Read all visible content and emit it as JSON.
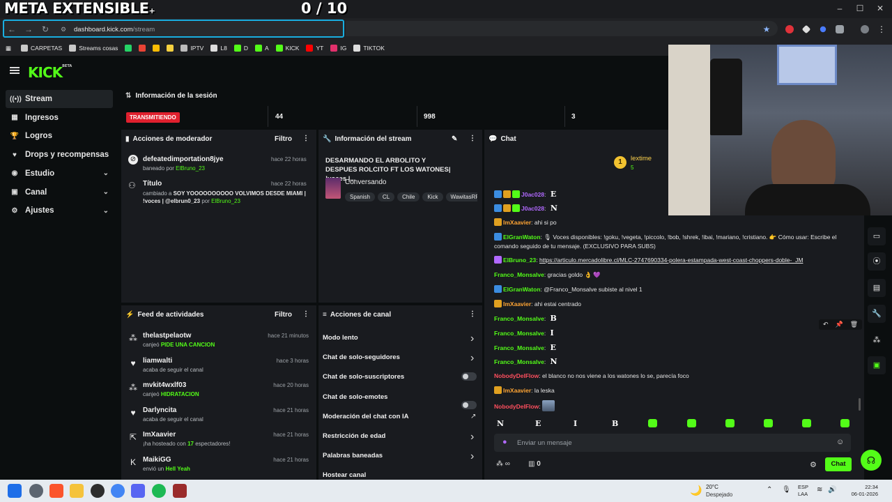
{
  "overlay": {
    "title": "META EXTENSIBLE",
    "plus": "+",
    "counter": "0 / 10"
  },
  "browser": {
    "url_host": "dashboard.kick.com",
    "url_path": "/stream",
    "window_controls": [
      "–",
      "☐",
      "✕"
    ],
    "bookmarks": [
      {
        "label": "CARPETAS",
        "color": "#c9c9c9"
      },
      {
        "label": "Streams cosas",
        "color": "#c9c9c9"
      },
      {
        "label": "",
        "color": "#25d366"
      },
      {
        "label": "",
        "color": "#ea4335"
      },
      {
        "label": "",
        "color": "#fbbc04"
      },
      {
        "label": "",
        "color": "#f4d03f"
      },
      {
        "label": "IPTV",
        "color": "#bbbbbb"
      },
      {
        "label": "L8",
        "color": "#dddddd"
      },
      {
        "label": "D",
        "color": "#53fc18"
      },
      {
        "label": "A",
        "color": "#53fc18"
      },
      {
        "label": "KICK",
        "color": "#53fc18"
      },
      {
        "label": "YT",
        "color": "#ff0000"
      },
      {
        "label": "IG",
        "color": "#e1306c"
      },
      {
        "label": "TIKTOK",
        "color": "#dddddd"
      }
    ]
  },
  "kick": {
    "logo": "KICK",
    "logo_sup": "BETA",
    "nav": [
      {
        "label": "Stream",
        "icon": "stream-icon",
        "glyph": "((•))",
        "chev": false,
        "active": true
      },
      {
        "label": "Ingresos",
        "icon": "revenue-icon",
        "glyph": "▦",
        "chev": false
      },
      {
        "label": "Logros",
        "icon": "trophy-icon",
        "glyph": "🏆",
        "chev": false
      },
      {
        "label": "Drops y recompensas",
        "icon": "drops-icon",
        "glyph": "♥",
        "chev": false
      },
      {
        "label": "Estudio",
        "icon": "studio-icon",
        "glyph": "◉",
        "chev": true
      },
      {
        "label": "Canal",
        "icon": "channel-icon",
        "glyph": "▣",
        "chev": true
      },
      {
        "label": "Ajustes",
        "icon": "settings-icon",
        "glyph": "⚙",
        "chev": true
      }
    ],
    "session": {
      "title": "Información de la sesión",
      "status": "TRANSMITIENDO",
      "stats": [
        "44",
        "998",
        "3"
      ]
    },
    "mod_actions": {
      "title": "Acciones de moderador",
      "filter": "Filtro",
      "items": [
        {
          "user": "defeatedimportation8jye",
          "time": "hace 22 horas",
          "action": "baneado por",
          "by": "ElBruno_23"
        },
        {
          "user": "Título",
          "time": "hace 22 horas",
          "action": "cambiado a",
          "bold": "SOY YOOOOOOOOOO VOLVIMOS DESDE MIAMI | !voces | @elbrun0_23",
          "por": "por",
          "by": "ElBruno_23"
        }
      ]
    },
    "stream_info": {
      "title": "Información del stream",
      "stream_title": "DESARMANDO EL ARBOLITO Y DESPUES ROLCITO FT LOS WATONES| !voces |...",
      "category": "Conversando",
      "tags": [
        "Spanish",
        "CL",
        "Chile",
        "Kick",
        "WawitasRF"
      ]
    },
    "activity": {
      "title": "Feed de actividades",
      "filter": "Filtro",
      "items": [
        {
          "user": "thelastpelaotw",
          "time": "hace 21 minutos",
          "pre": "canjeó",
          "hl": "PIDE UNA CANCION",
          "post": "",
          "icon": "redeem-icon",
          "glyph": "⁂"
        },
        {
          "user": "liamwalti",
          "time": "hace 3 horas",
          "pre": "acaba de seguir el canal",
          "hl": "",
          "post": "",
          "icon": "heart-icon",
          "glyph": "♥"
        },
        {
          "user": "mvkit4wxlf03",
          "time": "hace 20 horas",
          "pre": "canjeó",
          "hl": "HIDRATACION",
          "post": "",
          "icon": "redeem-icon",
          "glyph": "⁂"
        },
        {
          "user": "Darlyncita",
          "time": "hace 21 horas",
          "pre": "acaba de seguir el canal",
          "hl": "",
          "post": "",
          "icon": "heart-icon",
          "glyph": "♥"
        },
        {
          "user": "ImXaavier",
          "time": "hace 21 horas",
          "pre": "¡ha hosteado con",
          "hl": "17",
          "post": "espectadores!",
          "icon": "host-icon",
          "glyph": "⇱"
        },
        {
          "user": "MaikiGG",
          "time": "hace 21 horas",
          "pre": "envió un",
          "hl": "Hell Yeah",
          "post": "",
          "icon": "kick-icon",
          "glyph": "K"
        }
      ]
    },
    "channel_actions": {
      "title": "Acciones de canal",
      "items": [
        {
          "label": "Modo lento",
          "ctrl": "arrow"
        },
        {
          "label": "Chat de solo-seguidores",
          "ctrl": "arrow"
        },
        {
          "label": "Chat de solo-suscriptores",
          "ctrl": "toggle"
        },
        {
          "label": "Chat de solo-emotes",
          "ctrl": "toggle"
        },
        {
          "label": "Moderación del chat con IA",
          "ctrl": "ext"
        },
        {
          "label": "Restricción de edad",
          "ctrl": "arrow"
        },
        {
          "label": "Palabras baneadas",
          "ctrl": "arrow"
        },
        {
          "label": "Hostear canal",
          "ctrl": "none"
        }
      ]
    },
    "chat": {
      "title": "Chat",
      "top_user": "lextime",
      "top_user_count": "5",
      "top_rank": "1",
      "messages": [
        {
          "user": "J0ac028",
          "color": "#b169ff",
          "text": "",
          "emote": "E",
          "badges": [
            "#3b8ce0",
            "#e0a020",
            "#53fc18"
          ]
        },
        {
          "user": "J0ac028",
          "color": "#b169ff",
          "text": "",
          "emote": "N",
          "badges": [
            "#3b8ce0",
            "#e0a020",
            "#53fc18"
          ]
        },
        {
          "user": "ImXaavier",
          "color": "#ffa534",
          "text": "ahi si po",
          "emote": "",
          "badges": [
            "#e0a020"
          ]
        },
        {
          "user": "ElGranWaton",
          "color": "#53fc18",
          "text": "🎙 Voces disponibles: !goku, !vegeta, !piccolo, !bob, !shrek, !ibai, !mariano, !cristiano. 👉 Cómo usar: Escribe el comando seguido de tu mensaje. (EXCLUSIVO PARA SUBS)",
          "emote": "",
          "badges": [
            "#3b8ce0"
          ]
        },
        {
          "user": "ElBruno_23",
          "color": "#53fc18",
          "text": "https://articulo.mercadolibre.cl/MLC-2747690334-polera-estampada-west-coast-choppers-doble-_JM",
          "emote": "",
          "badges": [
            "#b169ff"
          ],
          "link": true
        },
        {
          "user": "Franco_Monsalve",
          "color": "#53fc18",
          "text": "gracias goldo 👌 💜",
          "emote": "",
          "badges": []
        },
        {
          "user": "ElGranWaton",
          "color": "#53fc18",
          "text": "@Franco_Monsalve subiste al nivel 1",
          "emote": "",
          "badges": [
            "#3b8ce0"
          ]
        },
        {
          "user": "ImXaavier",
          "color": "#ffa534",
          "text": "ahi estai centrado",
          "emote": "",
          "badges": [
            "#e0a020"
          ]
        },
        {
          "user": "Franco_Monsalve",
          "color": "#53fc18",
          "text": "",
          "emote": "B",
          "badges": []
        },
        {
          "user": "Franco_Monsalve",
          "color": "#53fc18",
          "text": "",
          "emote": "I",
          "badges": []
        },
        {
          "user": "Franco_Monsalve",
          "color": "#53fc18",
          "text": "",
          "emote": "E",
          "badges": []
        },
        {
          "user": "Franco_Monsalve",
          "color": "#53fc18",
          "text": "",
          "emote": "N",
          "badges": []
        },
        {
          "user": "NobodyDelFlow",
          "color": "#ff4f5e",
          "text": "el blanco no nos viene a los watones lo se, parecía foco",
          "emote": "",
          "badges": []
        },
        {
          "user": "ImXaavier",
          "color": "#ffa534",
          "text": "la leska",
          "emote": "",
          "badges": [
            "#e0a020"
          ]
        },
        {
          "user": "NobodyDelFlow",
          "color": "#ff4f5e",
          "text": "",
          "emote": "",
          "badges": [],
          "img": true
        }
      ],
      "emote_bar": [
        "N",
        "E",
        "I",
        "B"
      ],
      "input_placeholder": "Enviar un mensaje",
      "infinite_label": "∞",
      "points": "0",
      "send": "Chat"
    }
  },
  "taskbar": {
    "weather_temp": "20°C",
    "weather_desc": "Despejado",
    "lang1": "ESP",
    "lang2": "LAA",
    "time": "22:34",
    "date": "06-01-2026"
  }
}
